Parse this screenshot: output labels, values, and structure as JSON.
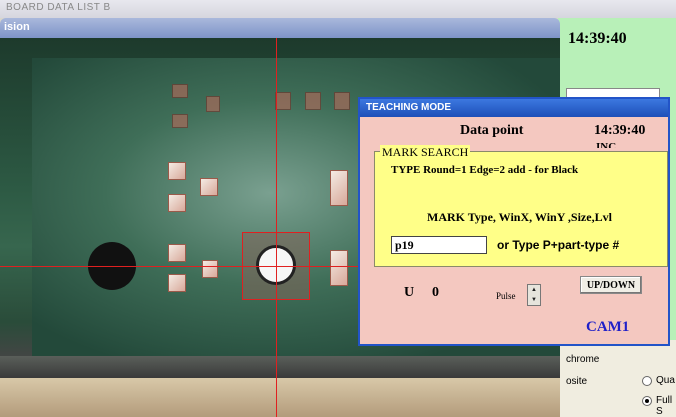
{
  "background": {
    "top_title": "BOARD DATA LIST B",
    "vision_title": "ision",
    "clock": "14:39:40",
    "options": {
      "item1": "chrome",
      "item2": "osite",
      "radio1": "Qua",
      "radio2": "Full S"
    }
  },
  "dialog": {
    "title": "TEACHING MODE",
    "data_point_label": "Data point",
    "time": "14:39:40",
    "ghost_text": "INC",
    "mark_search": {
      "legend": "MARK SEARCH",
      "type_line": "TYPE Round=1 Edge=2 add - for Black",
      "fields_line": "MARK Type, WinX, WinY ,Size,Lvl",
      "input_value": "p19",
      "hint": "or Type P+part-type #"
    },
    "u_label": "U",
    "u_value": "0",
    "pulse_label": "Pulse",
    "updown_button": "UP/DOWN",
    "camera": "CAM1"
  },
  "colors": {
    "crosshair": "#e02020",
    "dialog_bg": "#f4c8c0",
    "mark_box_bg": "#ffff88",
    "title_bar": "#1d4fb8",
    "cam_label": "#2020c8",
    "right_panel": "#b8f0b8"
  }
}
